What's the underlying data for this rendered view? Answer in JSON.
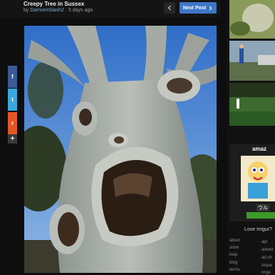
{
  "post": {
    "title": "Creepy Tree in Sussex",
    "by": "by",
    "author": "DamsenSlash2",
    "time_ago": "5 days ago"
  },
  "nav": {
    "prev_icon": "chevron-left-icon",
    "next_label": "Next Post",
    "next_icon": "chevron-right-icon"
  },
  "share": {
    "facebook": "f",
    "twitter": "t",
    "reddit": "r",
    "more": "+"
  },
  "sidebar": {
    "ad_brand": "amaz",
    "ad_badge": "ウル",
    "love_text": "Love Imgur?",
    "links_left": [
      "about",
      "store",
      "help",
      "blog",
      "terms"
    ],
    "links_right": [
      "api",
      "advert",
      "ad ch",
      "reque",
      "imgu"
    ]
  },
  "colors": {
    "accent": "#3e77c7",
    "facebook": "#3b5a98",
    "twitter": "#3aa7dd",
    "reddit": "#e45623"
  }
}
